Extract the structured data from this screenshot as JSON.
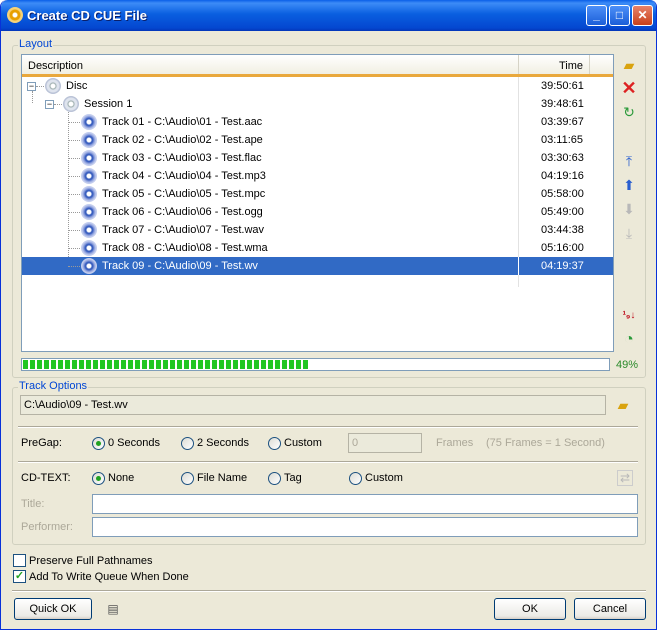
{
  "window": {
    "title": "Create CD CUE File",
    "minimize": "_",
    "maximize": "□",
    "close": "✕"
  },
  "layout": {
    "label": "Layout",
    "columns": {
      "description": "Description",
      "time": "Time"
    },
    "disc": {
      "label": "Disc",
      "time": "39:50:61"
    },
    "session": {
      "label": "Session 1",
      "time": "39:48:61"
    },
    "tracks": [
      {
        "label": "Track 01 - C:\\Audio\\01 - Test.aac",
        "time": "03:39:67"
      },
      {
        "label": "Track 02 - C:\\Audio\\02 - Test.ape",
        "time": "03:11:65"
      },
      {
        "label": "Track 03 - C:\\Audio\\03 - Test.flac",
        "time": "03:30:63"
      },
      {
        "label": "Track 04 - C:\\Audio\\04 - Test.mp3",
        "time": "04:19:16"
      },
      {
        "label": "Track 05 - C:\\Audio\\05 - Test.mpc",
        "time": "05:58:00"
      },
      {
        "label": "Track 06 - C:\\Audio\\06 - Test.ogg",
        "time": "05:49:00"
      },
      {
        "label": "Track 07 - C:\\Audio\\07 - Test.wav",
        "time": "03:44:38"
      },
      {
        "label": "Track 08 - C:\\Audio\\08 - Test.wma",
        "time": "05:16:00"
      },
      {
        "label": "Track 09 - C:\\Audio\\09 - Test.wv",
        "time": "04:19:37"
      }
    ],
    "selected_index": 8,
    "progress": {
      "percent": 49,
      "text": "49%"
    }
  },
  "side_icons": [
    "open-folder-icon",
    "delete-icon",
    "refresh-icon",
    "move-top-icon",
    "move-up-icon",
    "move-down-icon",
    "move-bottom-icon",
    "sort-icon",
    "time-icon"
  ],
  "track_options": {
    "label": "Track Options",
    "path": "C:\\Audio\\09 - Test.wv",
    "pregap": {
      "label": "PreGap:",
      "options": [
        "0 Seconds",
        "2 Seconds",
        "Custom"
      ],
      "selected": "0 Seconds",
      "frames_value": "0",
      "frames_label": "Frames",
      "frames_hint": "(75 Frames = 1 Second)"
    },
    "cdtext": {
      "label": "CD-TEXT:",
      "options": [
        "None",
        "File Name",
        "Tag",
        "Custom"
      ],
      "selected": "None"
    },
    "title_label": "Title:",
    "title_value": "",
    "performer_label": "Performer:",
    "performer_value": ""
  },
  "options": {
    "preserve_pathnames": {
      "label": "Preserve Full Pathnames",
      "checked": false
    },
    "add_to_queue": {
      "label": "Add To Write Queue When Done",
      "checked": true
    }
  },
  "buttons": {
    "quick_ok": "Quick OK",
    "ok": "OK",
    "cancel": "Cancel"
  },
  "colors": {
    "selection": "#316ac5",
    "progress": "#22c622",
    "group_label": "#0046d5"
  }
}
